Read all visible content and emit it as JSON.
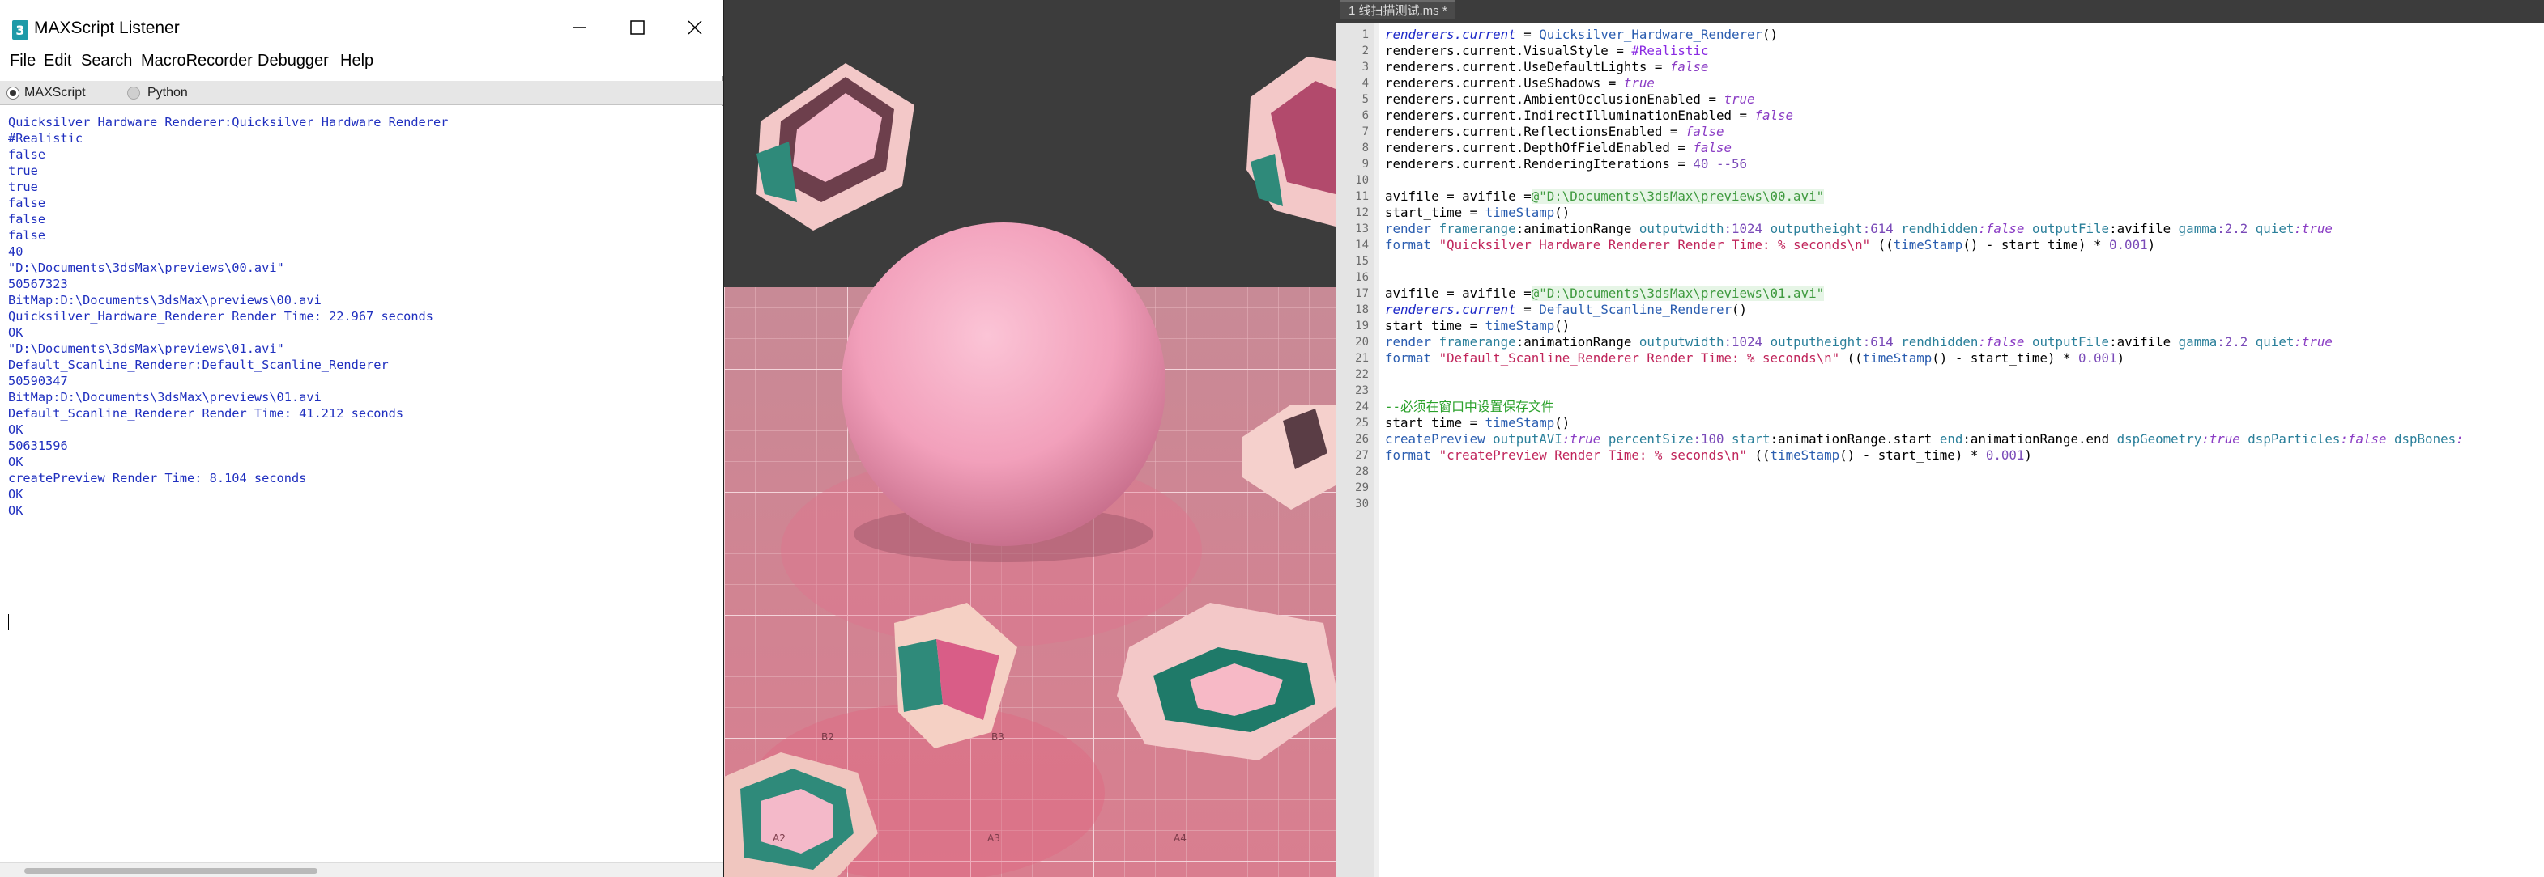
{
  "listener": {
    "title": "MAXScript Listener",
    "menu": [
      "File",
      "Edit",
      "Search",
      "MacroRecorder",
      "Debugger",
      "Help"
    ],
    "tabs": [
      "MAXScript",
      "Python"
    ],
    "output_lines": [
      "Quicksilver_Hardware_Renderer:Quicksilver_Hardware_Renderer",
      "#Realistic",
      "false",
      "true",
      "true",
      "false",
      "false",
      "false",
      "40",
      "\"D:\\Documents\\3dsMax\\previews\\00.avi\"",
      "50567323",
      "BitMap:D:\\Documents\\3dsMax\\previews\\00.avi",
      "Quicksilver_Hardware_Renderer Render Time: 22.967 seconds",
      "OK",
      "\"D:\\Documents\\3dsMax\\previews\\01.avi\"",
      "Default_Scanline_Renderer:Default_Scanline_Renderer",
      "50590347",
      "BitMap:D:\\Documents\\3dsMax\\previews\\01.avi",
      "Default_Scanline_Renderer Render Time: 41.212 seconds",
      "OK",
      "50631596",
      "OK",
      "createPreview Render Time: 8.104 seconds",
      "OK",
      "OK"
    ]
  },
  "viewport": {
    "grid_labels": [
      "B2",
      "B3",
      "A2",
      "A3",
      "A4"
    ]
  },
  "editor": {
    "tab_title": "1 线扫描测试.ms *",
    "line_numbers": [
      "1",
      "2",
      "3",
      "4",
      "5",
      "6",
      "7",
      "8",
      "9",
      "10",
      "11",
      "12",
      "13",
      "14",
      "15",
      "16",
      "17",
      "18",
      "19",
      "20",
      "21",
      "22",
      "23",
      "24",
      "25",
      "26",
      "27",
      "28",
      "29",
      "30"
    ],
    "lines": [
      [
        [
          "k",
          "renderers.current"
        ],
        [
          "",
          ". = "
        ],
        [
          "fn",
          "Quicksilver_Hardware_Renderer"
        ],
        [
          "",
          "()"
        ]
      ],
      [
        [
          "",
          "renderers.current.VisualStyle = "
        ],
        [
          "n",
          "#Realistic"
        ]
      ],
      [
        [
          "",
          "renderers.current.UseDefaultLights = "
        ],
        [
          "b",
          "false"
        ]
      ],
      [
        [
          "",
          "renderers.current.UseShadows = "
        ],
        [
          "b",
          "true"
        ]
      ],
      [
        [
          "",
          "renderers.current.AmbientOcclusionEnabled = "
        ],
        [
          "b",
          "true"
        ]
      ],
      [
        [
          "",
          "renderers.current.IndirectIlluminationEnabled = "
        ],
        [
          "b",
          "false"
        ]
      ],
      [
        [
          "",
          "renderers.current.ReflectionsEnabled = "
        ],
        [
          "b",
          "false"
        ]
      ],
      [
        [
          "",
          "renderers.current.DepthOfFieldEnabled = "
        ],
        [
          "b",
          "false"
        ]
      ],
      [
        [
          "",
          "renderers.current.RenderingIterations = "
        ],
        [
          "p",
          "40 --56"
        ]
      ],
      [],
      [
        [
          "",
          "avifile = avifile ="
        ],
        [
          "s",
          "@\"D:\\Documents\\3dsMax\\previews\\00.avi\""
        ]
      ],
      [
        [
          "",
          "start_time = "
        ],
        [
          "fn",
          "timeStamp"
        ],
        [
          "",
          "()"
        ]
      ],
      [
        [
          "fn",
          "render "
        ],
        [
          "v",
          "framerange"
        ],
        [
          "",
          ":animationRange "
        ],
        [
          "v",
          "outputwidth"
        ],
        [
          "p",
          ":1024 "
        ],
        [
          "v",
          "outputheight"
        ],
        [
          "p",
          ":614 "
        ],
        [
          "v",
          "rendhidden"
        ],
        [
          "b",
          ":false "
        ],
        [
          "v",
          "outputFile"
        ],
        [
          "",
          ":avifile "
        ],
        [
          "v",
          "gamma"
        ],
        [
          "p",
          ":2.2 "
        ],
        [
          "v",
          "quiet"
        ],
        [
          "b",
          ":true"
        ]
      ],
      [
        [
          "fn",
          "format "
        ],
        [
          "vs",
          "\"Quicksilver_Hardware_Renderer Render Time: % seconds\\n\""
        ],
        [
          "",
          " (("
        ],
        [
          "fn",
          "timeStamp"
        ],
        [
          "",
          "() - start_time) * "
        ],
        [
          "p",
          "0.001"
        ],
        [
          "",
          ")"
        ]
      ],
      [],
      [],
      [
        [
          "",
          "avifile = avifile ="
        ],
        [
          "s",
          "@\"D:\\Documents\\3dsMax\\previews\\01.avi\""
        ]
      ],
      [
        [
          "k",
          "renderers.current"
        ],
        [
          "",
          " = "
        ],
        [
          "fn",
          "Default_Scanline_Renderer"
        ],
        [
          "",
          "()"
        ]
      ],
      [
        [
          "",
          "start_time = "
        ],
        [
          "fn",
          "timeStamp"
        ],
        [
          "",
          "()"
        ]
      ],
      [
        [
          "fn",
          "render "
        ],
        [
          "v",
          "framerange"
        ],
        [
          "",
          ":animationRange "
        ],
        [
          "v",
          "outputwidth"
        ],
        [
          "p",
          ":1024 "
        ],
        [
          "v",
          "outputheight"
        ],
        [
          "p",
          ":614 "
        ],
        [
          "v",
          "rendhidden"
        ],
        [
          "b",
          ":false "
        ],
        [
          "v",
          "outputFile"
        ],
        [
          "",
          ":avifile "
        ],
        [
          "v",
          "gamma"
        ],
        [
          "p",
          ":2.2 "
        ],
        [
          "v",
          "quiet"
        ],
        [
          "b",
          ":true"
        ]
      ],
      [
        [
          "fn",
          "format "
        ],
        [
          "vs",
          "\"Default_Scanline_Renderer Render Time: % seconds\\n\""
        ],
        [
          "",
          " (("
        ],
        [
          "fn",
          "timeStamp"
        ],
        [
          "",
          "() - start_time) * "
        ],
        [
          "p",
          "0.001"
        ],
        [
          "",
          ")"
        ]
      ],
      [],
      [],
      [
        [
          "c",
          "--必须在窗口中设置保存文件"
        ]
      ],
      [
        [
          "",
          "start_time = "
        ],
        [
          "fn",
          "timeStamp"
        ],
        [
          "",
          "()"
        ]
      ],
      [
        [
          "fn",
          "createPreview "
        ],
        [
          "v",
          "outputAVI"
        ],
        [
          "b",
          ":true "
        ],
        [
          "v",
          "percentSize"
        ],
        [
          "p",
          ":100 "
        ],
        [
          "v",
          "start"
        ],
        [
          "",
          ":animationRange.start "
        ],
        [
          "v",
          "end"
        ],
        [
          "",
          ":animationRange.end "
        ],
        [
          "v",
          "dspGeometry"
        ],
        [
          "b",
          ":true "
        ],
        [
          "v",
          "dspParticles"
        ],
        [
          "b",
          ":false "
        ],
        [
          "v",
          "dspBones"
        ],
        [
          "b",
          ":"
        ]
      ],
      [
        [
          "fn",
          "format "
        ],
        [
          "vs",
          "\"createPreview Render Time: % seconds\\n\""
        ],
        [
          "",
          " (("
        ],
        [
          "fn",
          "timeStamp"
        ],
        [
          "",
          "() - start_time) * "
        ],
        [
          "p",
          "0.001"
        ],
        [
          "",
          ")"
        ]
      ],
      [],
      [],
      []
    ]
  },
  "colors": {
    "listener_output": "#1f2fbf",
    "editor_tab_bg": "#3c3c3c",
    "floor_pink": "#d98a9a",
    "sphere_pink": "#f2a8c0"
  }
}
